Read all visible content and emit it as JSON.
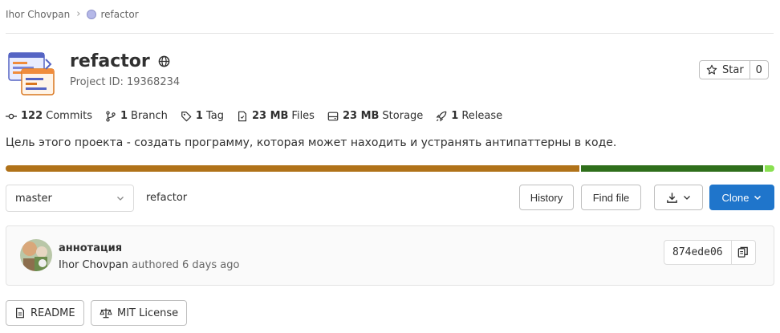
{
  "breadcrumb": {
    "owner": "Ihor Chovpan",
    "project": "refactor"
  },
  "project": {
    "name": "refactor",
    "id_text": "Project ID: 19368234",
    "description": "Цель этого проекта - создать программу, которая может находить и устранять антипаттерны в коде."
  },
  "star": {
    "label": "Star",
    "count": "0"
  },
  "stats": {
    "commits_count": "122",
    "commits_label": "Commits",
    "branch_count": "1",
    "branch_label": "Branch",
    "tag_count": "1",
    "tag_label": "Tag",
    "files_size": "23 MB",
    "files_label": "Files",
    "storage_size": "23 MB",
    "storage_label": "Storage",
    "release_count": "1",
    "release_label": "Release"
  },
  "language_bar": [
    {
      "share": 0.749,
      "color": "#b07219"
    },
    {
      "share": 0.238,
      "color": "#2f6f1b"
    },
    {
      "share": 0.013,
      "color": "#89e051"
    }
  ],
  "repo": {
    "branch": "master",
    "path": "refactor",
    "history_label": "History",
    "find_file_label": "Find file",
    "clone_label": "Clone"
  },
  "last_commit": {
    "title": "аннотация",
    "author": "Ihor Chovpan",
    "authored_text": "authored 6 days ago",
    "sha": "874ede06"
  },
  "docs": {
    "readme_label": "README",
    "license_label": "MIT License"
  },
  "colors": {
    "accent": "#1f75cb",
    "text": "#303030",
    "muted": "#666666"
  }
}
